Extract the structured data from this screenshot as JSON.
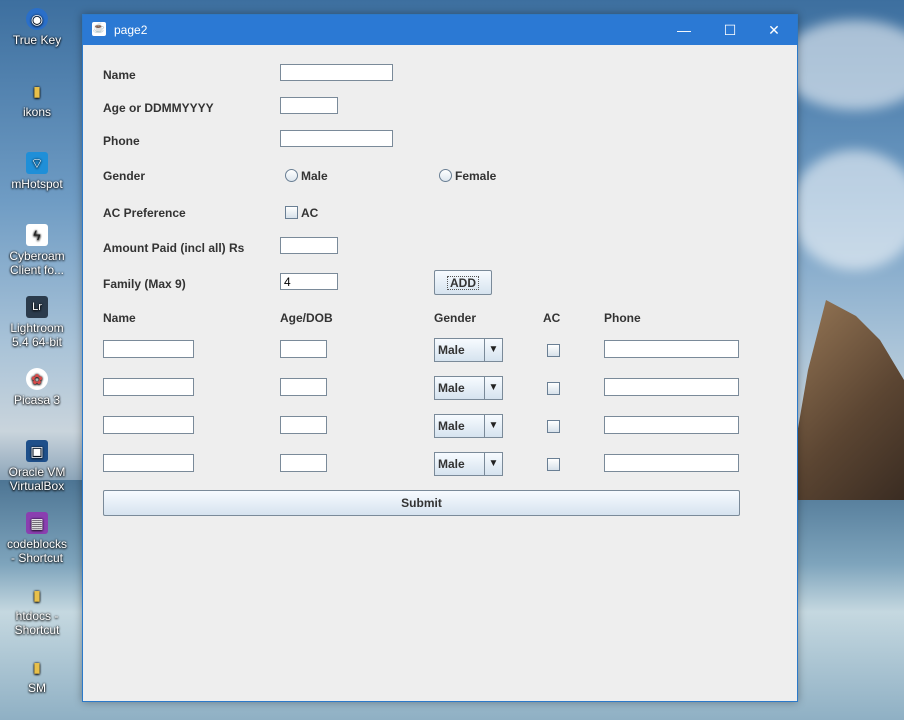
{
  "desktop": {
    "icons": [
      {
        "label": "True Key",
        "glyph": "◉",
        "color": "#2a6fc9"
      },
      {
        "label": "ikons",
        "glyph": "▮",
        "color": "#e8c04a"
      },
      {
        "label": "mHotspot",
        "glyph": "⌔",
        "color": "#1f8fd8"
      },
      {
        "label": "Cyberoam Client fo...",
        "glyph": "ϟ",
        "color": "#222222"
      },
      {
        "label": "Lightroom 5.4 64-bit",
        "glyph": "Lr",
        "color": "#2b3b4c"
      },
      {
        "label": "Picasa 3",
        "glyph": "✿",
        "color": "#d84a4a"
      },
      {
        "label": "Oracle VM VirtualBox",
        "glyph": "▣",
        "color": "#1e4f8a"
      },
      {
        "label": "codeblocks - Shortcut",
        "glyph": "▦",
        "color": "#8a3fb0"
      },
      {
        "label": "htdocs - Shortcut",
        "glyph": "▮",
        "color": "#e8c04a"
      },
      {
        "label": "SM",
        "glyph": "▮",
        "color": "#e8c04a"
      }
    ]
  },
  "window": {
    "title": "page2",
    "minimize": "—",
    "maximize": "☐",
    "close": "✕"
  },
  "form": {
    "name_label": "Name",
    "age_label": "Age or DDMMYYYY",
    "phone_label": "Phone",
    "gender_label": "Gender",
    "male_label": "Male",
    "female_label": "Female",
    "ac_pref_label": "AC Preference",
    "ac_label": "AC",
    "amount_label": "Amount Paid (incl all) Rs",
    "family_label": "Family (Max 9)",
    "family_value": "4",
    "add_label": "ADD"
  },
  "table": {
    "headers": {
      "name": "Name",
      "age": "Age/DOB",
      "gender": "Gender",
      "ac": "AC",
      "phone": "Phone"
    },
    "rows": [
      {
        "name": "",
        "age": "",
        "gender": "Male",
        "phone": ""
      },
      {
        "name": "",
        "age": "",
        "gender": "Male",
        "phone": ""
      },
      {
        "name": "",
        "age": "",
        "gender": "Male",
        "phone": ""
      },
      {
        "name": "",
        "age": "",
        "gender": "Male",
        "phone": ""
      }
    ]
  },
  "submit_label": "Submit"
}
